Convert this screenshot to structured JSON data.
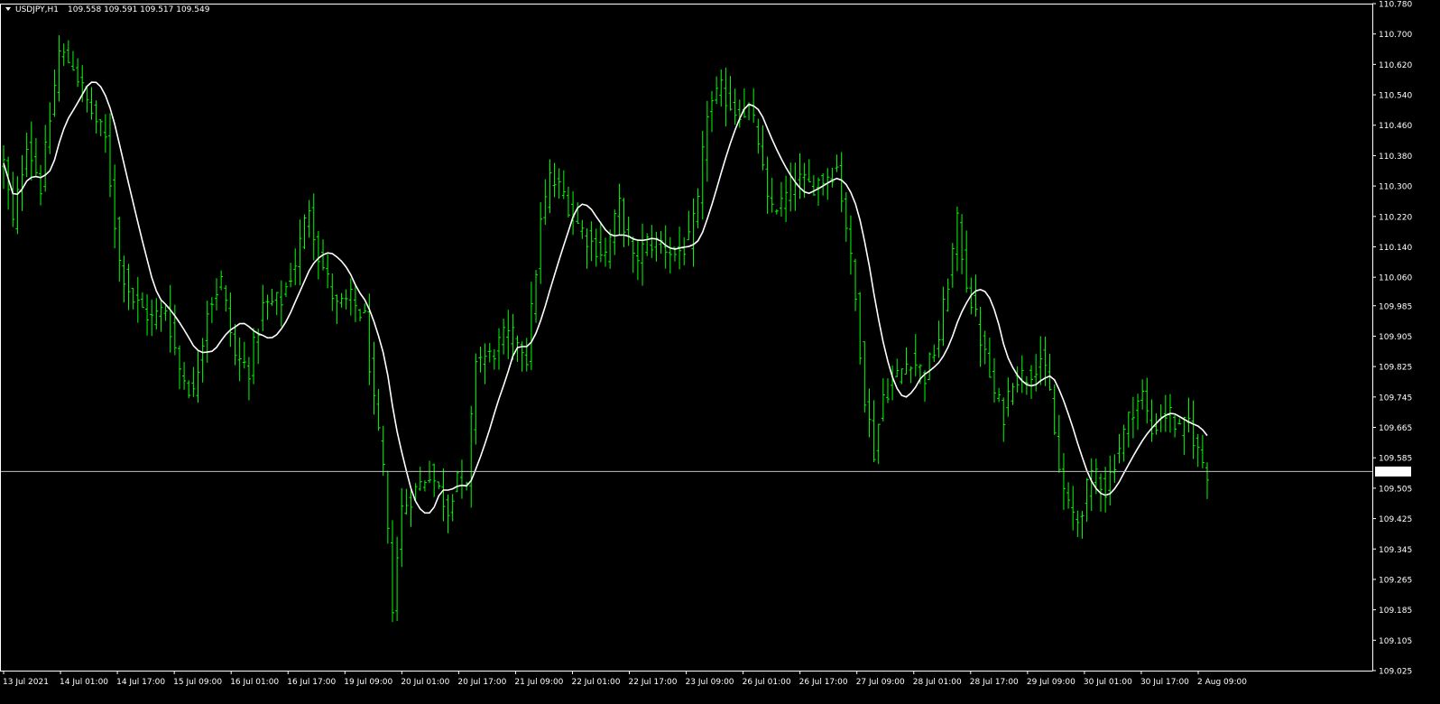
{
  "symbol_info": {
    "symbol": "USDJPY,H1",
    "ohlc": "109.558 109.591 109.517 109.549"
  },
  "colors": {
    "background": "#000000",
    "axis": "#ffffff",
    "bars": "#00ff00",
    "moving_average": "#ffffff",
    "price_line": "#c0c0c0",
    "price_label_bg": "#ffffff",
    "price_label_text": "#000000"
  },
  "chart_data": {
    "type": "line",
    "chart_style": "ohlc-bars-with-moving-average",
    "grid": false,
    "ylim": [
      109.025,
      110.78
    ],
    "yticks": [
      "110.780",
      "110.700",
      "110.620",
      "110.540",
      "110.460",
      "110.380",
      "110.300",
      "110.220",
      "110.140",
      "110.060",
      "109.985",
      "109.905",
      "109.825",
      "109.745",
      "109.665",
      "109.585",
      "109.505",
      "109.425",
      "109.345",
      "109.265",
      "109.185",
      "109.105",
      "109.025"
    ],
    "xticks": [
      "13 Jul 2021",
      "14 Jul 01:00",
      "14 Jul 17:00",
      "15 Jul 09:00",
      "16 Jul 01:00",
      "16 Jul 17:00",
      "19 Jul 09:00",
      "20 Jul 01:00",
      "20 Jul 17:00",
      "21 Jul 09:00",
      "22 Jul 01:00",
      "22 Jul 17:00",
      "23 Jul 09:00",
      "26 Jul 01:00",
      "26 Jul 17:00",
      "27 Jul 09:00",
      "28 Jul 01:00",
      "28 Jul 17:00",
      "29 Jul 09:00",
      "30 Jul 01:00",
      "30 Jul 17:00",
      "2 Aug 09:00"
    ],
    "current_price": "109.549",
    "price_keypoints": [
      [
        0,
        110.36
      ],
      [
        2,
        110.2
      ],
      [
        5,
        110.42
      ],
      [
        8,
        110.3
      ],
      [
        12,
        110.65
      ],
      [
        15,
        110.62
      ],
      [
        18,
        110.52
      ],
      [
        22,
        110.42
      ],
      [
        25,
        110.1
      ],
      [
        28,
        110.0
      ],
      [
        32,
        109.95
      ],
      [
        35,
        109.98
      ],
      [
        38,
        109.82
      ],
      [
        41,
        109.75
      ],
      [
        44,
        109.98
      ],
      [
        47,
        110.05
      ],
      [
        50,
        109.85
      ],
      [
        53,
        109.82
      ],
      [
        56,
        109.98
      ],
      [
        60,
        110.0
      ],
      [
        63,
        110.1
      ],
      [
        66,
        110.25
      ],
      [
        68,
        110.12
      ],
      [
        72,
        109.98
      ],
      [
        75,
        110.0
      ],
      [
        78,
        109.95
      ],
      [
        80,
        109.72
      ],
      [
        82,
        109.55
      ],
      [
        84,
        109.2
      ],
      [
        86,
        109.45
      ],
      [
        89,
        109.5
      ],
      [
        92,
        109.55
      ],
      [
        94,
        109.5
      ],
      [
        96,
        109.45
      ],
      [
        98,
        109.55
      ],
      [
        100,
        109.5
      ],
      [
        102,
        109.85
      ],
      [
        105,
        109.85
      ],
      [
        108,
        109.9
      ],
      [
        111,
        109.9
      ],
      [
        113,
        109.85
      ],
      [
        116,
        110.2
      ],
      [
        118,
        110.32
      ],
      [
        121,
        110.28
      ],
      [
        124,
        110.2
      ],
      [
        127,
        110.15
      ],
      [
        130,
        110.12
      ],
      [
        133,
        110.25
      ],
      [
        136,
        110.1
      ],
      [
        139,
        110.15
      ],
      [
        142,
        110.15
      ],
      [
        145,
        110.12
      ],
      [
        148,
        110.15
      ],
      [
        150,
        110.25
      ],
      [
        152,
        110.5
      ],
      [
        155,
        110.55
      ],
      [
        158,
        110.5
      ],
      [
        161,
        110.5
      ],
      [
        163,
        110.42
      ],
      [
        165,
        110.25
      ],
      [
        168,
        110.25
      ],
      [
        171,
        110.32
      ],
      [
        174,
        110.3
      ],
      [
        177,
        110.32
      ],
      [
        180,
        110.35
      ],
      [
        182,
        110.2
      ],
      [
        184,
        110.0
      ],
      [
        186,
        109.75
      ],
      [
        188,
        109.6
      ],
      [
        190,
        109.75
      ],
      [
        193,
        109.8
      ],
      [
        196,
        109.85
      ],
      [
        199,
        109.8
      ],
      [
        202,
        109.9
      ],
      [
        204,
        110.05
      ],
      [
        206,
        110.2
      ],
      [
        208,
        110.05
      ],
      [
        210,
        109.95
      ],
      [
        212,
        109.85
      ],
      [
        214,
        109.75
      ],
      [
        216,
        109.7
      ],
      [
        218,
        109.8
      ],
      [
        221,
        109.8
      ],
      [
        224,
        109.85
      ],
      [
        226,
        109.75
      ],
      [
        228,
        109.55
      ],
      [
        230,
        109.45
      ],
      [
        232,
        109.42
      ],
      [
        234,
        109.5
      ],
      [
        236,
        109.55
      ],
      [
        238,
        109.5
      ],
      [
        240,
        109.58
      ],
      [
        242,
        109.65
      ],
      [
        244,
        109.72
      ],
      [
        246,
        109.75
      ],
      [
        248,
        109.65
      ],
      [
        250,
        109.7
      ],
      [
        252,
        109.7
      ],
      [
        254,
        109.65
      ],
      [
        256,
        109.68
      ],
      [
        258,
        109.6
      ],
      [
        260,
        109.55
      ]
    ]
  }
}
